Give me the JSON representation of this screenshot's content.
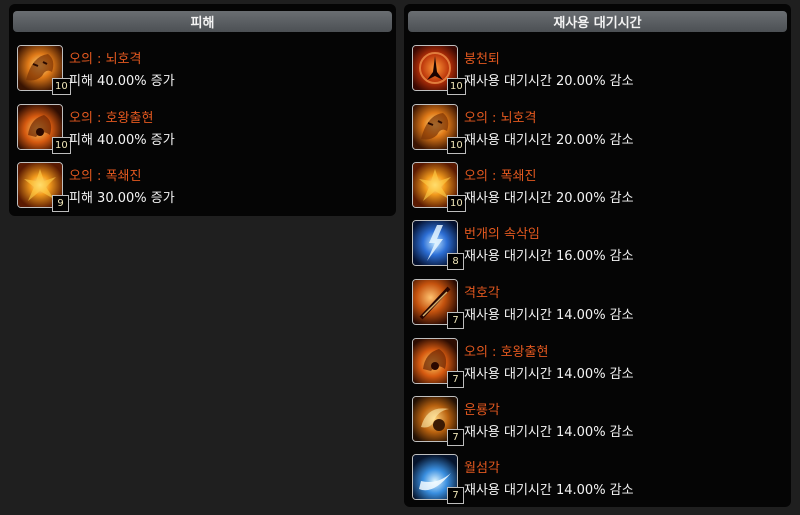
{
  "left_panel": {
    "title": "피해",
    "skills": [
      {
        "name": "오의 : 뇌호격",
        "effect": "피해 40.00% 증가",
        "level": "10",
        "icon": "tiger-icon"
      },
      {
        "name": "오의 : 호왕출현",
        "effect": "피해 40.00% 증가",
        "level": "10",
        "icon": "roaring-tiger-icon"
      },
      {
        "name": "오의 : 폭쇄진",
        "effect": "피해 30.00% 증가",
        "level": "9",
        "icon": "explosion-icon"
      }
    ]
  },
  "right_panel": {
    "title": "재사용 대기시간",
    "skills": [
      {
        "name": "붕천퇴",
        "effect": "재사용 대기시간 20.00% 감소",
        "level": "10",
        "icon": "kick-icon"
      },
      {
        "name": "오의 : 뇌호격",
        "effect": "재사용 대기시간 20.00% 감소",
        "level": "10",
        "icon": "tiger-icon"
      },
      {
        "name": "오의 : 폭쇄진",
        "effect": "재사용 대기시간 20.00% 감소",
        "level": "10",
        "icon": "explosion-icon"
      },
      {
        "name": "번개의 속삭임",
        "effect": "재사용 대기시간 16.00% 감소",
        "level": "8",
        "icon": "lightning-icon"
      },
      {
        "name": "격호각",
        "effect": "재사용 대기시간 14.00% 감소",
        "level": "7",
        "icon": "tiger-kick-icon"
      },
      {
        "name": "오의 : 호왕출현",
        "effect": "재사용 대기시간 14.00% 감소",
        "level": "7",
        "icon": "roaring-tiger-icon"
      },
      {
        "name": "운룡각",
        "effect": "재사용 대기시간 14.00% 감소",
        "level": "7",
        "icon": "dragon-kick-icon"
      },
      {
        "name": "월섬각",
        "effect": "재사용 대기시간 14.00% 감소",
        "level": "7",
        "icon": "moon-slash-icon"
      }
    ]
  },
  "colors": {
    "skill_name": "#e2581f",
    "effect_text": "#f4f4f4",
    "level_text": "#f0e6b8"
  }
}
